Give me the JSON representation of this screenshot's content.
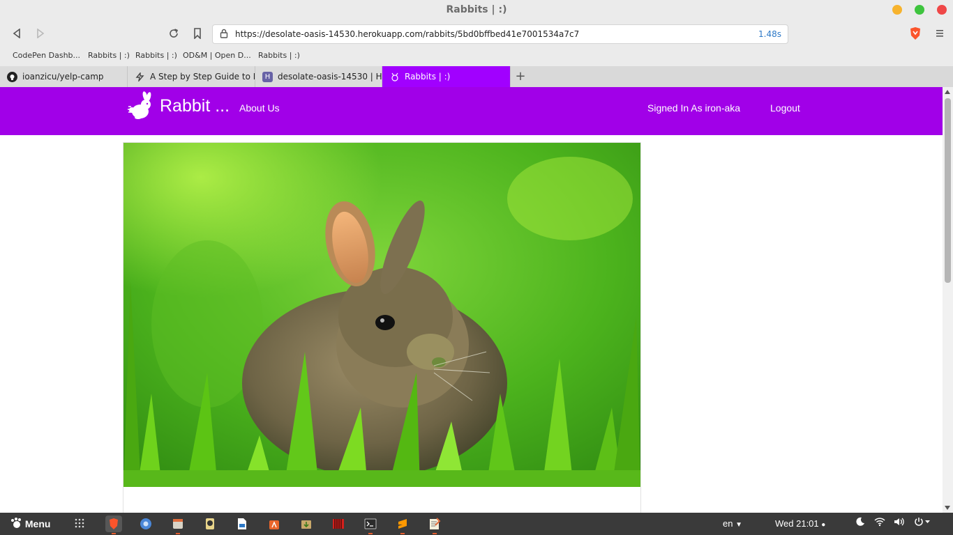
{
  "window": {
    "title": "Rabbits | :)"
  },
  "toolbar": {
    "url": "https://desolate-oasis-14530.herokuapp.com/rabbits/5bd0bffbed41e7001534a7c7",
    "load_time": "1.48s"
  },
  "bookmarks": [
    "CodePen Dashb...",
    "Rabbits | :)",
    "Rabbits | :)",
    "OD&M | Open D...",
    "Rabbits | :)"
  ],
  "tabs": [
    {
      "label": "ioanzicu/yelp-camp",
      "icon": "github-icon"
    },
    {
      "label": "A Step by Step Guide to Bu",
      "icon": "codeburst-icon"
    },
    {
      "label": "desolate-oasis-14530 | Her",
      "icon": "heroku-icon"
    },
    {
      "label": "Rabbits | :)",
      "icon": "rabbit-icon",
      "active": true
    }
  ],
  "navbar": {
    "brand": "Rabbit ...",
    "about": "About Us",
    "signed_in": "Signed In As iron-aka",
    "logout": "Logout",
    "color": "#a100e8"
  },
  "taskbar": {
    "menu": "Menu",
    "lang": "en",
    "clock": "Wed 21:01"
  }
}
